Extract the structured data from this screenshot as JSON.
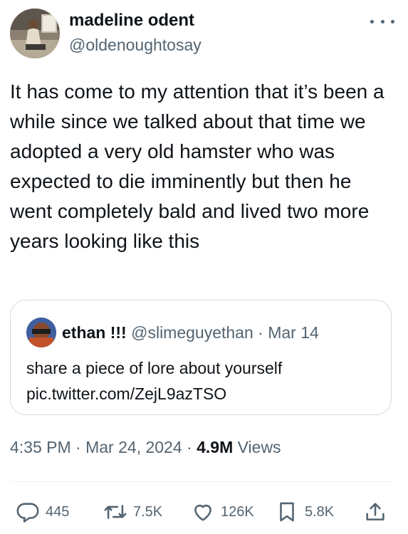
{
  "author": {
    "display_name": "madeline odent",
    "handle": "@oldenoughtosay"
  },
  "tweet": {
    "text": "It has come to my attention that it’s been a while since we talked about that time we adopted a very old hamster who was expected to die imminently but then he went completely bald and lived two more years looking like this"
  },
  "quoted": {
    "display_name": "ethan !!!",
    "handle": "@slimeguyethan",
    "separator": "·",
    "date": "Mar 14",
    "text": "share a piece of lore about yourself pic.twitter.com/ZejL9azTSO"
  },
  "meta": {
    "time": "4:35 PM",
    "separator": "·",
    "date": "Mar 24, 2024",
    "views_count": "4.9M",
    "views_label": "Views"
  },
  "actions": {
    "replies": "445",
    "retweets": "7.5K",
    "likes": "126K",
    "bookmarks": "5.8K"
  },
  "icons": {
    "more": "more-horizontal-icon",
    "reply": "reply-icon",
    "retweet": "retweet-icon",
    "like": "heart-icon",
    "bookmark": "bookmark-icon",
    "share": "share-icon"
  },
  "colors": {
    "text_primary": "#0f1419",
    "text_secondary": "#536471",
    "border": "#cfd9de"
  }
}
